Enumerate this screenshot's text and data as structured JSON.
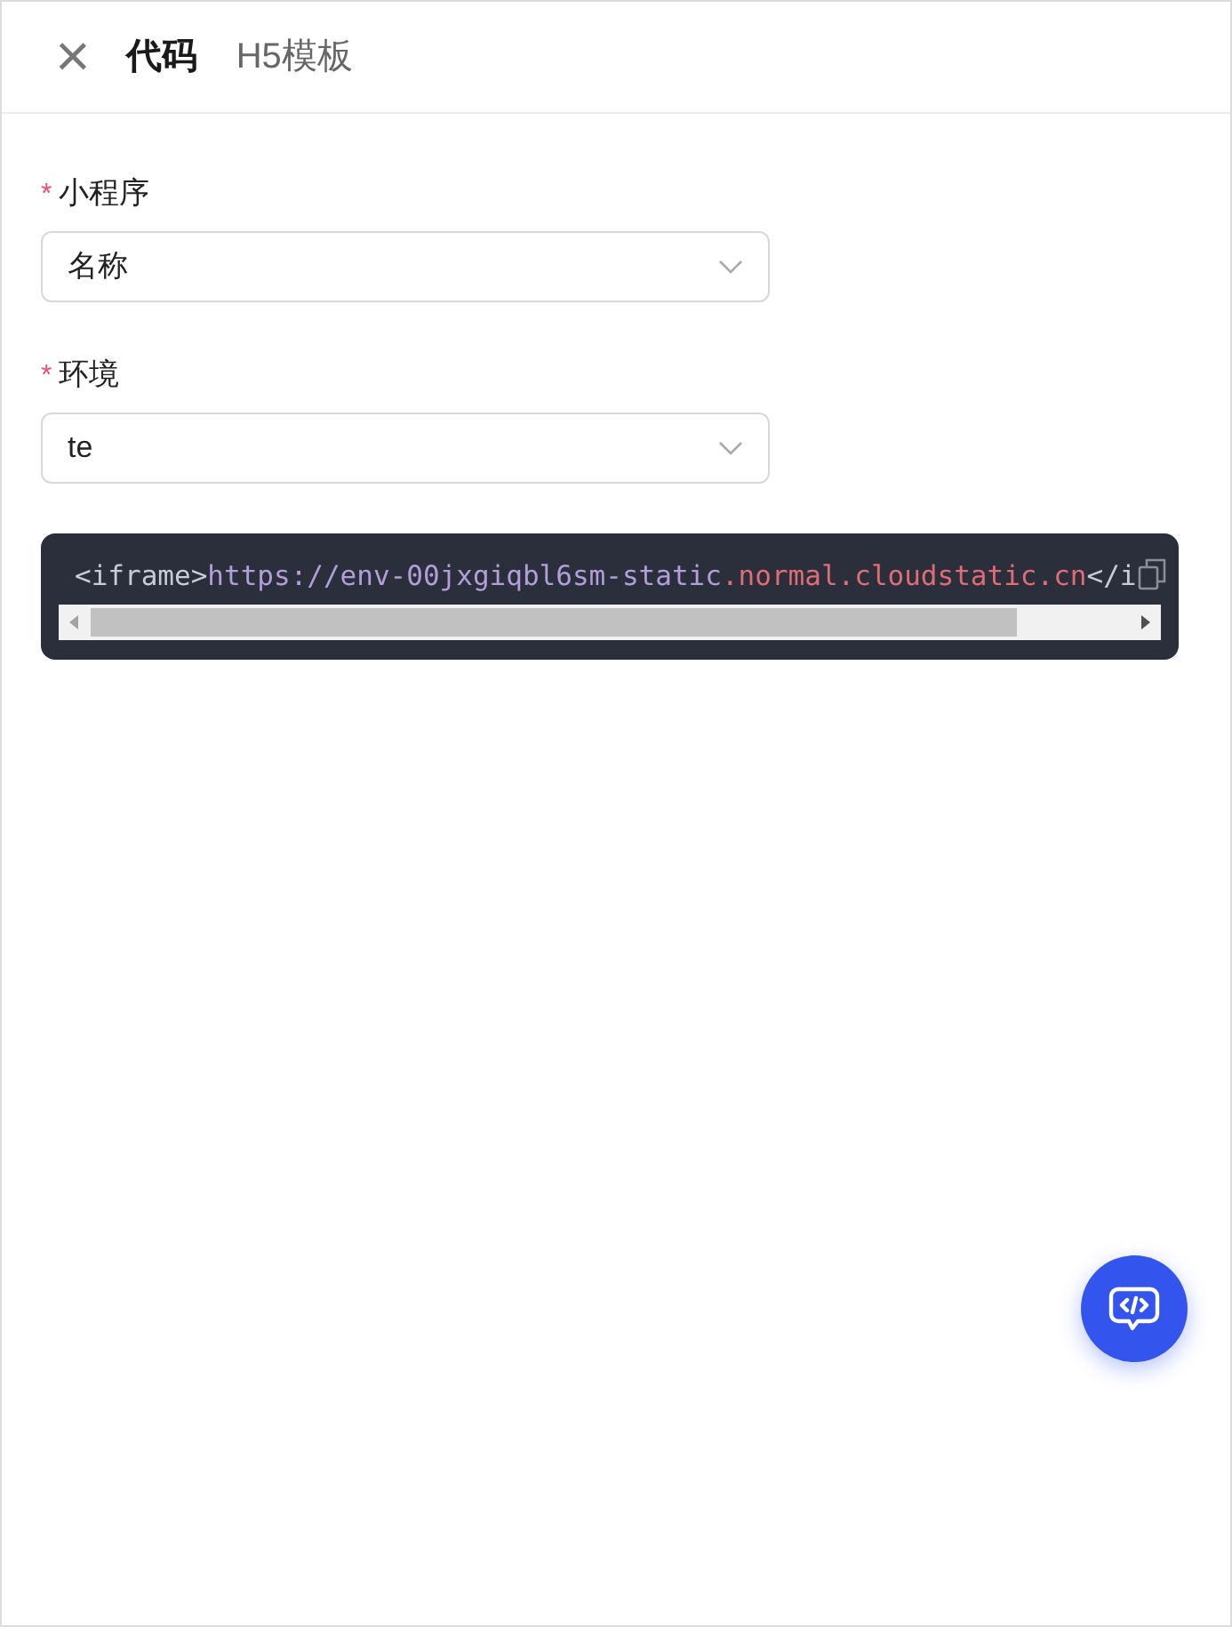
{
  "header": {
    "close": "×",
    "tabs": [
      {
        "label": "代码",
        "selected": true
      },
      {
        "label": "H5模板",
        "selected": false
      }
    ]
  },
  "fields": [
    {
      "label": "小程序",
      "required": "*",
      "value": "名称"
    },
    {
      "label": "环境",
      "required": "*",
      "value": "te"
    }
  ],
  "code": {
    "tokens": [
      {
        "kind": "tag",
        "text": "<iframe>"
      },
      {
        "kind": "url",
        "text": "https://env-00jxgiqbl6sm-static"
      },
      {
        "kind": "domain",
        "text": ".normal.cloudstatic.cn"
      },
      {
        "kind": "tag",
        "text": "</i"
      }
    ]
  }
}
